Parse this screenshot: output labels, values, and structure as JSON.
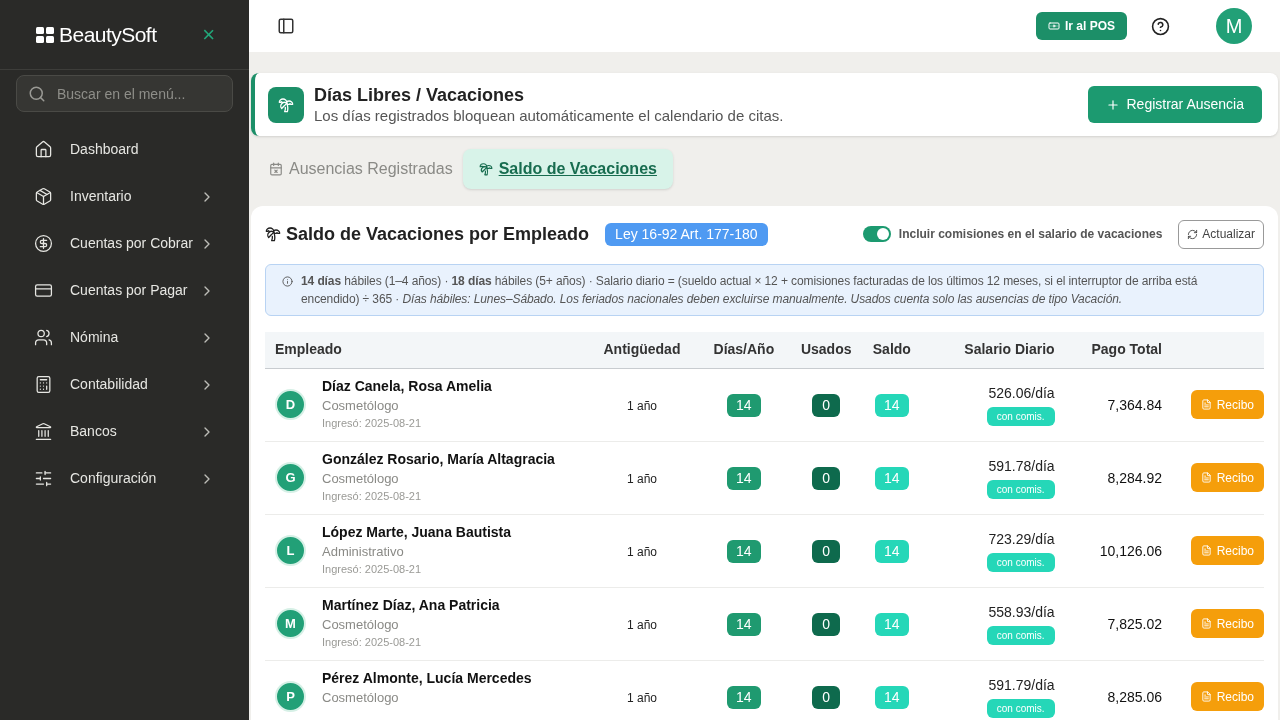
{
  "sidebar": {
    "brand": "BeautySoft",
    "close": "×",
    "search": {
      "placeholder": "Buscar en el menú..."
    },
    "items": [
      {
        "label": "Dashboard",
        "has_children": false
      },
      {
        "label": "Inventario",
        "has_children": true
      },
      {
        "label": "Cuentas por Cobrar",
        "has_children": true
      },
      {
        "label": "Cuentas por Pagar",
        "has_children": true
      },
      {
        "label": "Nómina",
        "has_children": true
      },
      {
        "label": "Contabilidad",
        "has_children": true
      },
      {
        "label": "Bancos",
        "has_children": true
      },
      {
        "label": "Configuración",
        "has_children": true
      }
    ]
  },
  "topbar": {
    "pos_button": "Ir al POS",
    "avatar": "M"
  },
  "header": {
    "title": "Días Libres / Vacaciones",
    "subtitle": "Los días registrados bloquean automáticamente el calendario de citas.",
    "action": "Registrar Ausencia"
  },
  "tabs": [
    {
      "label": "Ausencias Registradas",
      "selected": false
    },
    {
      "label": "Saldo de Vacaciones",
      "selected": true
    }
  ],
  "panel": {
    "title": "Saldo de Vacaciones por Empleado",
    "law_badge": "Ley 16-92 Art. 177-180",
    "toggle": {
      "label": "Incluir comisiones en el salario de vacaciones",
      "on": true
    },
    "refresh": "Actualizar",
    "info": "**14 días** hábiles (1–4 años) · **18 días** hábiles (5+ años) · Salario diario = (sueldo actual × 12 + comisiones facturadas de los últimos 12 meses, si el interruptor de arriba está encendido) ÷ 365 · *Días hábiles: Lunes–Sábado. Los feriados nacionales deben excluirse manualmente. Usados cuenta solo las ausencias de tipo Vacación.*"
  },
  "table": {
    "columns": [
      "Empleado",
      "Antigüedad",
      "Días/Año",
      "Usados",
      "Saldo",
      "Salario Diario",
      "Pago Total"
    ],
    "rows": [
      {
        "initial": "D",
        "name": "Díaz Canela, Rosa Amelia",
        "role": "Cosmetólogo",
        "hired": "Ingresó: 2025-08-21",
        "seniority": "1 año",
        "days_year": "14",
        "used": "0",
        "balance": "14",
        "daily": "526.06/día",
        "commission": "con comis.",
        "total": "7,364.84",
        "receipt": "Recibo"
      },
      {
        "initial": "G",
        "name": "González Rosario, María Altagracia",
        "role": "Cosmetólogo",
        "hired": "Ingresó: 2025-08-21",
        "seniority": "1 año",
        "days_year": "14",
        "used": "0",
        "balance": "14",
        "daily": "591.78/día",
        "commission": "con comis.",
        "total": "8,284.92",
        "receipt": "Recibo"
      },
      {
        "initial": "L",
        "name": "López Marte, Juana Bautista",
        "role": "Administrativo",
        "hired": "Ingresó: 2025-08-21",
        "seniority": "1 año",
        "days_year": "14",
        "used": "0",
        "balance": "14",
        "daily": "723.29/día",
        "commission": "con comis.",
        "total": "10,126.06",
        "receipt": "Recibo"
      },
      {
        "initial": "M",
        "name": "Martínez Díaz, Ana Patricia",
        "role": "Cosmetólogo",
        "hired": "Ingresó: 2025-08-21",
        "seniority": "1 año",
        "days_year": "14",
        "used": "0",
        "balance": "14",
        "daily": "558.93/día",
        "commission": "con comis.",
        "total": "7,825.02",
        "receipt": "Recibo"
      },
      {
        "initial": "P",
        "name": "Pérez Almonte, Lucía Mercedes",
        "role": "Cosmetólogo",
        "seniority": "1 año",
        "days_year": "14",
        "used": "0",
        "balance": "14",
        "daily": "591.79/día",
        "commission": "con comis.",
        "total": "8,285.06",
        "receipt": "Recibo"
      }
    ]
  }
}
